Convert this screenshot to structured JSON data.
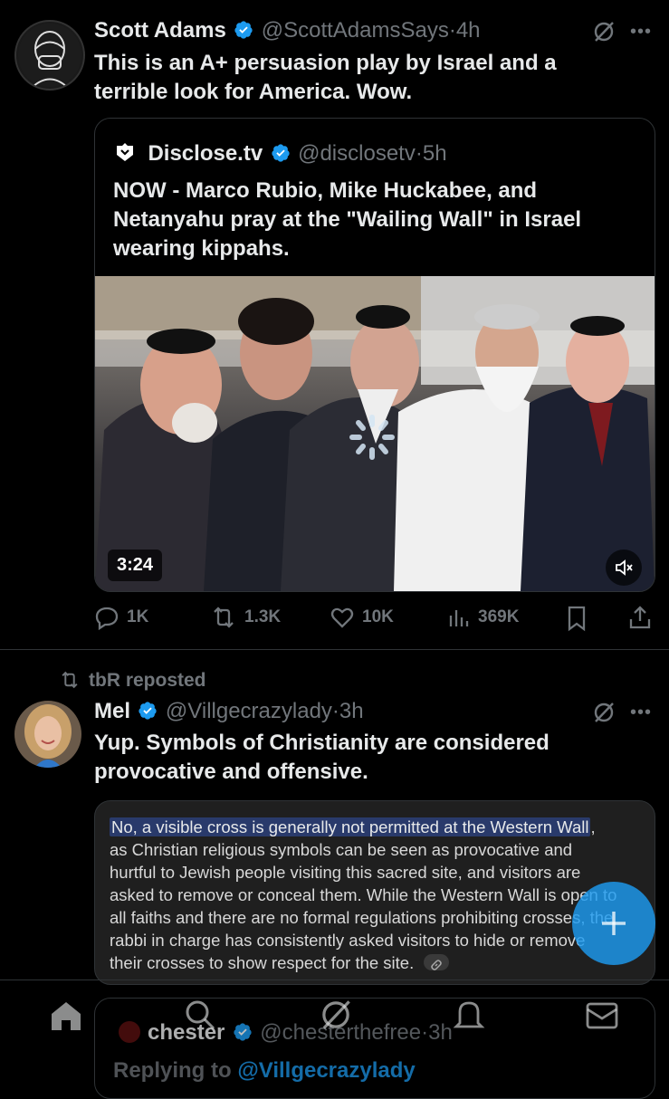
{
  "tweet1": {
    "name": "Scott Adams",
    "handle": "@ScottAdamsSays",
    "time": "4h",
    "text_line1": "This is an A+ persuasion play by Israel and a",
    "text_line2": "terrible look for America. Wow.",
    "quote": {
      "name": "Disclose.tv",
      "handle": "@disclosetv",
      "time": "5h",
      "text_line1": "NOW - Marco Rubio, Mike Huckabee, and",
      "text_line2": "Netanyahu pray at the \"Wailing Wall\" in Israel",
      "text_line3": "wearing kippahs.",
      "video_duration": "3:24"
    },
    "actions": {
      "replies": "1K",
      "reposts": "1.3K",
      "likes": "10K",
      "views": "369K"
    }
  },
  "repost_bar": {
    "text": "tbR reposted"
  },
  "tweet2": {
    "name": "Mel",
    "handle": "@Villgecrazylady",
    "time": "3h",
    "text_line1": "Yup. Symbols of Christianity are considered",
    "text_line2": "provocative and offensive.",
    "card": {
      "highlight": "No, a visible cross is generally not permitted at the Western Wall",
      "line1_rest": ",",
      "line2": "as Christian religious symbols can be seen as provocative and",
      "line3": "hurtful to Jewish people visiting this sacred site, and visitors are",
      "line4": "asked to remove or conceal them. While the Western Wall is open to",
      "line5": "all faiths and there are no formal regulations prohibiting crosses, the",
      "line6": "rabbi in charge has consistently asked visitors to hide or remove",
      "line7": "their crosses to show respect for the site."
    }
  },
  "tweet3": {
    "name": "chester",
    "handle": "@chesterthefree",
    "time": "3h",
    "replying_label": "Replying to",
    "replying_handle": "@Villgecrazylady"
  },
  "colors": {
    "accent": "#1d9bf0",
    "background": "#000000",
    "muted": "#71767b"
  }
}
